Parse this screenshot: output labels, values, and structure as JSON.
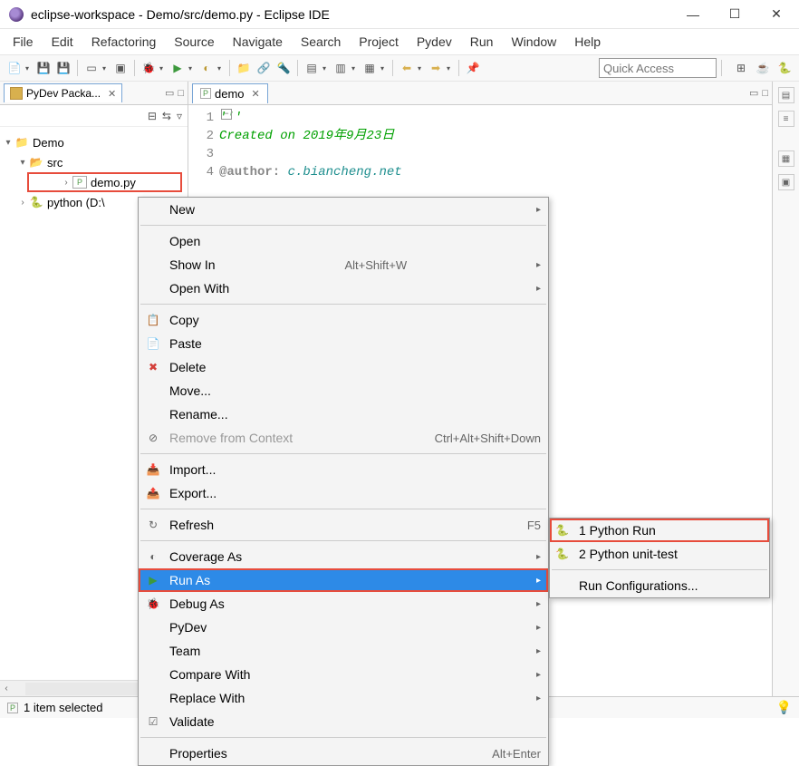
{
  "title": "eclipse-workspace - Demo/src/demo.py - Eclipse IDE",
  "menubar": [
    "File",
    "Edit",
    "Refactoring",
    "Source",
    "Navigate",
    "Search",
    "Project",
    "Pydev",
    "Run",
    "Window",
    "Help"
  ],
  "quick_access_placeholder": "Quick Access",
  "package_explorer": {
    "title": "PyDev Packa...",
    "tree": {
      "project": "Demo",
      "folder": "src",
      "file": "demo.py",
      "interpreter": "python (D:\\"
    }
  },
  "editor": {
    "tab": "demo",
    "lines": [
      {
        "n": 1,
        "type": "str",
        "text": "'''"
      },
      {
        "n": 2,
        "type": "str",
        "text": "Created on 2019年9月23日"
      },
      {
        "n": 3,
        "type": "str",
        "text": ""
      },
      {
        "n": 4,
        "type": "author",
        "label": "@author:",
        "value": "c.biancheng.net"
      }
    ]
  },
  "context_menu": {
    "items": [
      {
        "label": "New",
        "sub": true
      },
      {
        "sep": true
      },
      {
        "label": "Open"
      },
      {
        "label": "Show In",
        "shortcut": "Alt+Shift+W",
        "sub": true
      },
      {
        "label": "Open With",
        "sub": true
      },
      {
        "sep": true
      },
      {
        "label": "Copy",
        "icon": "📋"
      },
      {
        "label": "Paste",
        "icon": "📄"
      },
      {
        "label": "Delete",
        "icon": "✖",
        "iconColor": "#d43f3a"
      },
      {
        "label": "Move..."
      },
      {
        "label": "Rename..."
      },
      {
        "label": "Remove from Context",
        "shortcut": "Ctrl+Alt+Shift+Down",
        "disabled": true,
        "icon": "⊘"
      },
      {
        "sep": true
      },
      {
        "label": "Import...",
        "icon": "📥"
      },
      {
        "label": "Export...",
        "icon": "📤"
      },
      {
        "sep": true
      },
      {
        "label": "Refresh",
        "shortcut": "F5",
        "icon": "↻"
      },
      {
        "sep": true
      },
      {
        "label": "Coverage As",
        "sub": true,
        "icon": "◐"
      },
      {
        "label": "Run As",
        "sub": true,
        "icon": "▶",
        "iconColor": "#3d993d",
        "highlight": true
      },
      {
        "label": "Debug As",
        "sub": true,
        "icon": "🐞"
      },
      {
        "label": "PyDev",
        "sub": true
      },
      {
        "label": "Team",
        "sub": true
      },
      {
        "label": "Compare With",
        "sub": true
      },
      {
        "label": "Replace With",
        "sub": true
      },
      {
        "label": "Validate",
        "icon": "☑"
      },
      {
        "sep": true
      },
      {
        "label": "Properties",
        "shortcut": "Alt+Enter"
      }
    ]
  },
  "submenu": {
    "items": [
      {
        "label": "1 Python Run",
        "icon": "🐍",
        "highlight": true
      },
      {
        "label": "2 Python unit-test",
        "icon": "🐍"
      },
      {
        "sep": true
      },
      {
        "label": "Run Configurations..."
      }
    ]
  },
  "statusbar": "1 item selected"
}
